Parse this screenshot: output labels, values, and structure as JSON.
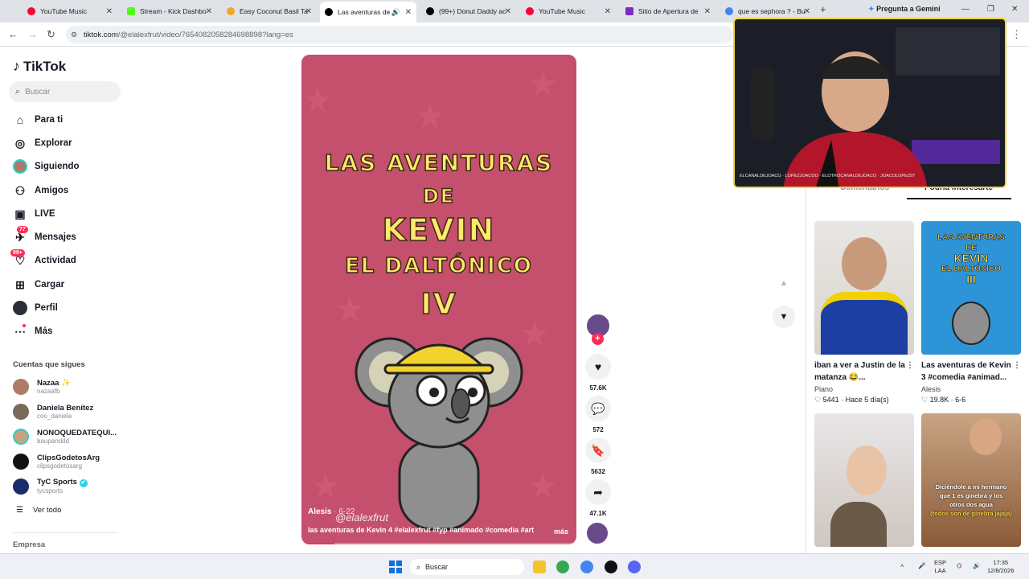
{
  "browser": {
    "tabs": [
      {
        "title": "YouTube Music",
        "color": "#ff0033"
      },
      {
        "title": "Stream - Kick Dashbo",
        "color": "#53fc18"
      },
      {
        "title": "Easy Coconut Basil Ta",
        "color": "#f5a623"
      },
      {
        "title": "Las aventuras de",
        "color": "#000000"
      },
      {
        "title": "(99+) Donut Daddy ac",
        "color": "#000000"
      },
      {
        "title": "YouTube Music",
        "color": "#ff0033"
      },
      {
        "title": "Sitio de Apertura de",
        "color": "#7b2cbf"
      },
      {
        "title": "que es sephora ? - Bu",
        "color": "#4285f4"
      }
    ],
    "gemini_label": "Pregunta a Gemini",
    "url_main": "tiktok.com",
    "url_path": "/@elalexfrut/video/7654082058284698898?lang=es"
  },
  "sidebar": {
    "logo": "TikTok",
    "search_placeholder": "Buscar",
    "nav": [
      {
        "label": "Para ti",
        "icon": "home-icon"
      },
      {
        "label": "Explorar",
        "icon": "compass-icon"
      },
      {
        "label": "Siguiendo",
        "icon": "following-avatar-icon"
      },
      {
        "label": "Amigos",
        "icon": "friends-icon"
      },
      {
        "label": "LIVE",
        "icon": "live-icon"
      },
      {
        "label": "Mensajes",
        "icon": "messages-icon",
        "badge": "77"
      },
      {
        "label": "Actividad",
        "icon": "activity-icon",
        "badge": "99+"
      },
      {
        "label": "Cargar",
        "icon": "upload-icon"
      },
      {
        "label": "Perfil",
        "icon": "profile-icon"
      },
      {
        "label": "Más",
        "icon": "more-icon"
      }
    ],
    "following_title": "Cuentas que sigues",
    "following": [
      {
        "name": "Nazaa ✨",
        "handle": "nazaafb",
        "color": "#b07a6a"
      },
      {
        "name": "Daniela Benítez",
        "handle": "coo_daniela",
        "color": "#7a6a5a"
      },
      {
        "name": "NONOQUEDATEQUI...",
        "handle": "baupanddd",
        "color": "#c7a27a"
      },
      {
        "name": "ClipsGodetosArg",
        "handle": "clipsgodetosarg",
        "color": "#111111"
      },
      {
        "name": "TyC Sports",
        "handle": "tycsports",
        "color": "#1b2a6b",
        "verified": "✔"
      }
    ],
    "see_all": "Ver todo",
    "company": "Empresa"
  },
  "video": {
    "title_lines": [
      "LAS AVENTURAS",
      "DE",
      "KEVIN",
      "EL DALTÓNICO",
      "IV"
    ],
    "watermark": "@elalexfrut",
    "author": "Alesis",
    "date": "· 6-22",
    "description": "las aventuras de Kevin 4 #elalexfrut #fyp #animado #comedia #art",
    "more": "más",
    "progress": 0.12,
    "likes": "57.6K",
    "comments": "572",
    "saves": "5632",
    "shares": "47.1K"
  },
  "right_panel": {
    "tab_comments": "Comentarios",
    "tab_interest": "Podría interesarte",
    "cards": [
      {
        "title": "iban a ver a Justin de la matanza 😂...",
        "author": "Piano",
        "likes": "5441",
        "date": "Hace 5 día(s)"
      },
      {
        "title": "Las aventuras de Kevin 3 #comedia #animad...",
        "author": "Alesis",
        "likes": "19.8K",
        "date": "6-6",
        "thumb_text": [
          "LAS AVENTURAS",
          "DE",
          "KEVIN",
          "EL DALTÓNICO",
          "III"
        ]
      },
      {
        "title": "",
        "author": "",
        "likes": "",
        "date": ""
      },
      {
        "title": "",
        "author": "",
        "likes": "",
        "date": "",
        "thumb_text": [
          "Diciéndole a mi hermano",
          "que 1 es ginebra y los",
          "otros dos agua",
          "(todos son de ginebra jajaja)"
        ]
      }
    ]
  },
  "pip": {
    "handles": "ELCANALDEJOACO · LOPEZJOACOO · ELOTROCANALDEJOACO · JOACOLOPEZ97"
  },
  "taskbar": {
    "search": "Buscar",
    "lang_top": "ESP",
    "lang_bottom": "LAA",
    "time": "17:35",
    "date": "12/8/2026"
  }
}
